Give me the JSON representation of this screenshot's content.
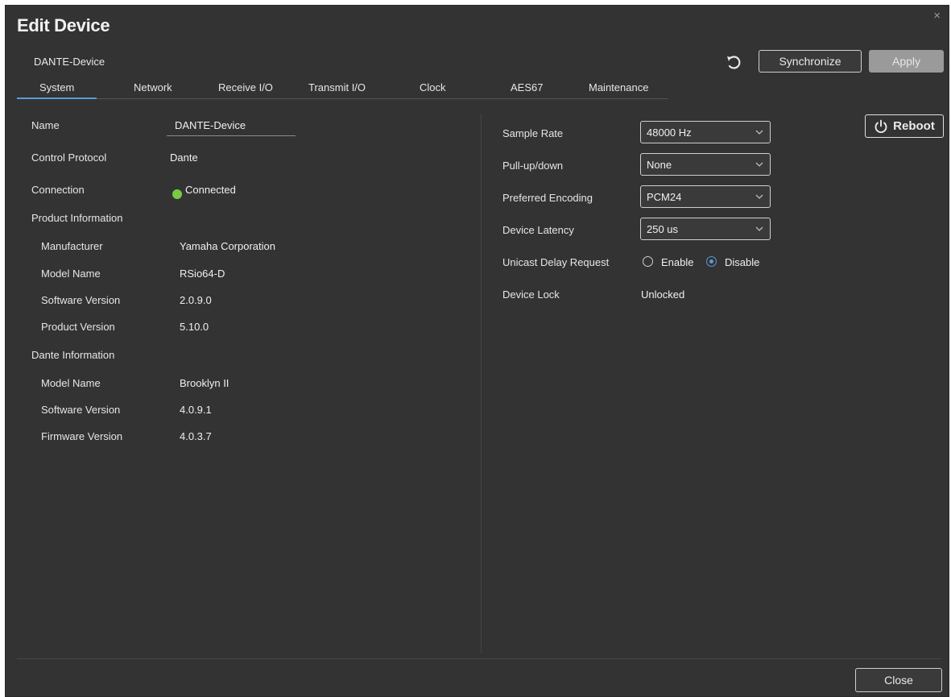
{
  "window": {
    "title": "Edit Device",
    "close_glyph": "×"
  },
  "device": {
    "name": "DANTE-Device"
  },
  "toolbar": {
    "sync_label": "Synchronize",
    "apply_label": "Apply",
    "undo_icon": "undo-icon"
  },
  "tabs": [
    {
      "label": "System",
      "active": true
    },
    {
      "label": "Network"
    },
    {
      "label": "Receive I/O"
    },
    {
      "label": "Transmit I/O"
    },
    {
      "label": "Clock"
    },
    {
      "label": "AES67"
    },
    {
      "label": "Maintenance"
    }
  ],
  "system": {
    "name_label": "Name",
    "name_value": "DANTE-Device",
    "protocol_label": "Control Protocol",
    "protocol_value": "Dante",
    "connection_label": "Connection",
    "connection_value": "Connected",
    "connection_color": "#7ac943",
    "product_info": {
      "heading": "Product Information",
      "manufacturer_label": "Manufacturer",
      "manufacturer_value": "Yamaha Corporation",
      "model_label": "Model Name",
      "model_value": "RSio64-D",
      "software_label": "Software Version",
      "software_value": "2.0.9.0",
      "product_label": "Product Version",
      "product_value": "5.10.0"
    },
    "dante_info": {
      "heading": "Dante Information",
      "model_label": "Model Name",
      "model_value": "Brooklyn II",
      "software_label": "Software Version",
      "software_value": "4.0.9.1",
      "firmware_label": "Firmware Version",
      "firmware_value": "4.0.3.7"
    }
  },
  "settings": {
    "sample_rate_label": "Sample Rate",
    "sample_rate_value": "48000 Hz",
    "pullupdown_label": "Pull-up/down",
    "pullupdown_value": "None",
    "encoding_label": "Preferred Encoding",
    "encoding_value": "PCM24",
    "latency_label": "Device Latency",
    "latency_value": "250 us",
    "unicast_label": "Unicast Delay Request",
    "unicast_enable": "Enable",
    "unicast_disable": "Disable",
    "unicast_selected": "Disable",
    "lock_label": "Device Lock",
    "lock_value": "Unlocked"
  },
  "reboot": {
    "label": "Reboot"
  },
  "footer": {
    "close_label": "Close"
  },
  "colors": {
    "accent": "#5b9bd5",
    "background": "#333333"
  }
}
